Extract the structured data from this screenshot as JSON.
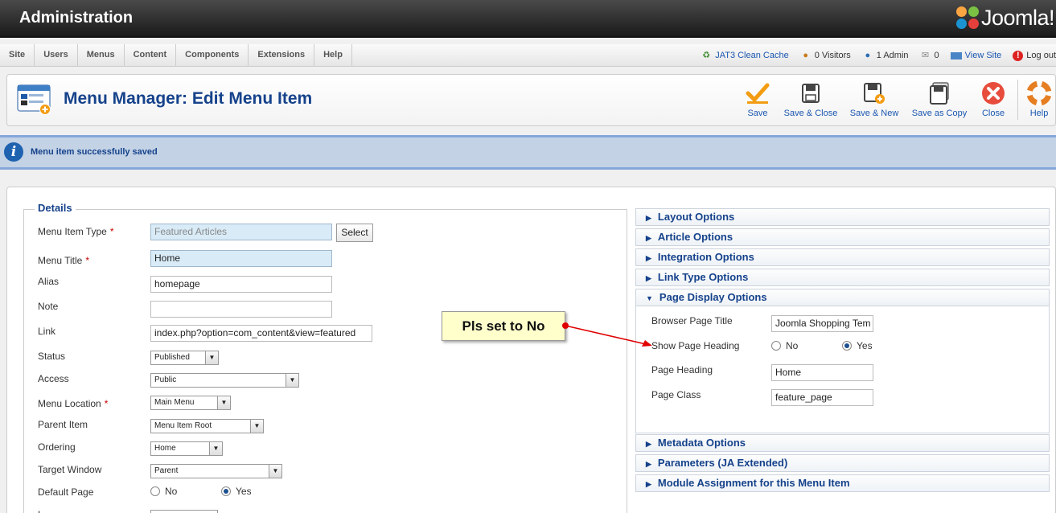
{
  "header": {
    "title": "Administration",
    "logo_text": "Joomla!"
  },
  "menubar": {
    "items": [
      "Site",
      "Users",
      "Menus",
      "Content",
      "Components",
      "Extensions",
      "Help"
    ],
    "status": {
      "cache": "JAT3 Clean Cache",
      "visitors": "0 Visitors",
      "admins": "1 Admin",
      "messages": "0",
      "view_site": "View Site",
      "logout": "Log out"
    }
  },
  "toolbar": {
    "title": "Menu Manager: Edit Menu Item",
    "buttons": {
      "save": "Save",
      "save_close": "Save & Close",
      "save_new": "Save & New",
      "save_copy": "Save as Copy",
      "close": "Close",
      "help": "Help"
    }
  },
  "message": "Menu item successfully saved",
  "details": {
    "legend": "Details",
    "menu_item_type": {
      "label": "Menu Item Type",
      "value": "Featured Articles",
      "button": "Select"
    },
    "menu_title": {
      "label": "Menu Title",
      "value": "Home"
    },
    "alias": {
      "label": "Alias",
      "value": "homepage"
    },
    "note": {
      "label": "Note",
      "value": ""
    },
    "link": {
      "label": "Link",
      "value": "index.php?option=com_content&view=featured"
    },
    "status": {
      "label": "Status",
      "value": "Published"
    },
    "access": {
      "label": "Access",
      "value": "Public"
    },
    "menu_location": {
      "label": "Menu Location",
      "value": "Main Menu"
    },
    "parent_item": {
      "label": "Parent Item",
      "value": "Menu Item Root"
    },
    "ordering": {
      "label": "Ordering",
      "value": "Home"
    },
    "target_window": {
      "label": "Target Window",
      "value": "Parent"
    },
    "default_page": {
      "label": "Default Page",
      "no": "No",
      "yes": "Yes",
      "selected": "Yes"
    },
    "required_mark": "*"
  },
  "accordion": {
    "layout": "Layout Options",
    "article": "Article Options",
    "integration": "Integration Options",
    "link_type": "Link Type Options",
    "page_display": "Page Display Options",
    "metadata": "Metadata Options",
    "parameters": "Parameters (JA Extended)",
    "module_assignment": "Module Assignment for this Menu Item"
  },
  "page_display": {
    "browser_title": {
      "label": "Browser Page Title",
      "value": "Joomla Shopping Tem"
    },
    "show_heading": {
      "label": "Show Page Heading",
      "no": "No",
      "yes": "Yes",
      "selected": "Yes"
    },
    "page_heading": {
      "label": "Page Heading",
      "value": "Home"
    },
    "page_class": {
      "label": "Page Class",
      "value": "feature_page"
    }
  },
  "annotation": {
    "text": "Pls set to No",
    "color": "#e00000"
  },
  "colors": {
    "accent": "#15428b",
    "header": "#1a1a1a",
    "message_bg": "#c3d2e5"
  }
}
